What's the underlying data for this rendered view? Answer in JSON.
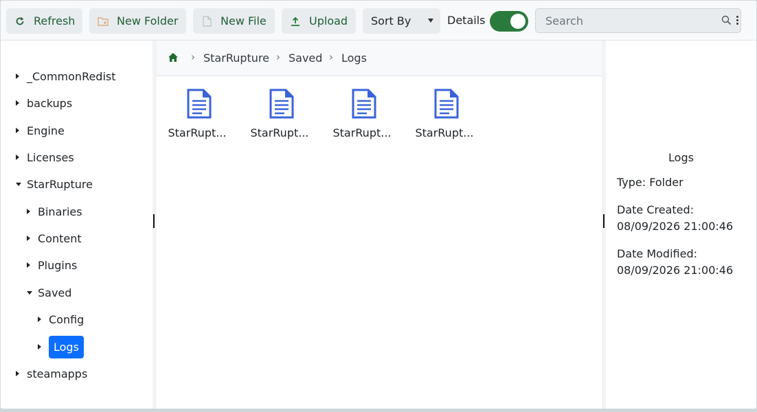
{
  "toolbar": {
    "refresh_label": "Refresh",
    "new_folder_label": "New Folder",
    "new_file_label": "New File",
    "upload_label": "Upload",
    "sort_label": "Sort By",
    "details_label": "Details",
    "details_enabled": true,
    "search_placeholder": "Search",
    "search_value": ""
  },
  "tree": {
    "items": [
      {
        "label": "_CommonRedist",
        "expanded": false
      },
      {
        "label": "backups",
        "expanded": false
      },
      {
        "label": "Engine",
        "expanded": false
      },
      {
        "label": "Licenses",
        "expanded": false
      },
      {
        "label": "StarRupture",
        "expanded": true
      },
      {
        "label": "Binaries",
        "expanded": false
      },
      {
        "label": "Content",
        "expanded": false
      },
      {
        "label": "Plugins",
        "expanded": false
      },
      {
        "label": "Saved",
        "expanded": true
      },
      {
        "label": "Config",
        "expanded": false
      },
      {
        "label": "Logs",
        "expanded": false,
        "selected": true
      },
      {
        "label": "steamapps",
        "expanded": false
      }
    ]
  },
  "breadcrumb": [
    "StarRupture",
    "Saved",
    "Logs"
  ],
  "files": [
    {
      "name": "StarRupt..."
    },
    {
      "name": "StarRupt..."
    },
    {
      "name": "StarRupt..."
    },
    {
      "name": "StarRupt..."
    }
  ],
  "details": {
    "title": "Logs",
    "type_line": "Type: Folder",
    "created_label": "Date Created:",
    "created_value": "08/09/2026 21:00:46",
    "modified_label": "Date Modified:",
    "modified_value": "08/09/2026 21:00:46"
  },
  "colors": {
    "accent": "#0d6efd",
    "toggle_on": "#2b7a3d",
    "button_text": "#1e5e34",
    "file_icon": "#3b63d9"
  }
}
